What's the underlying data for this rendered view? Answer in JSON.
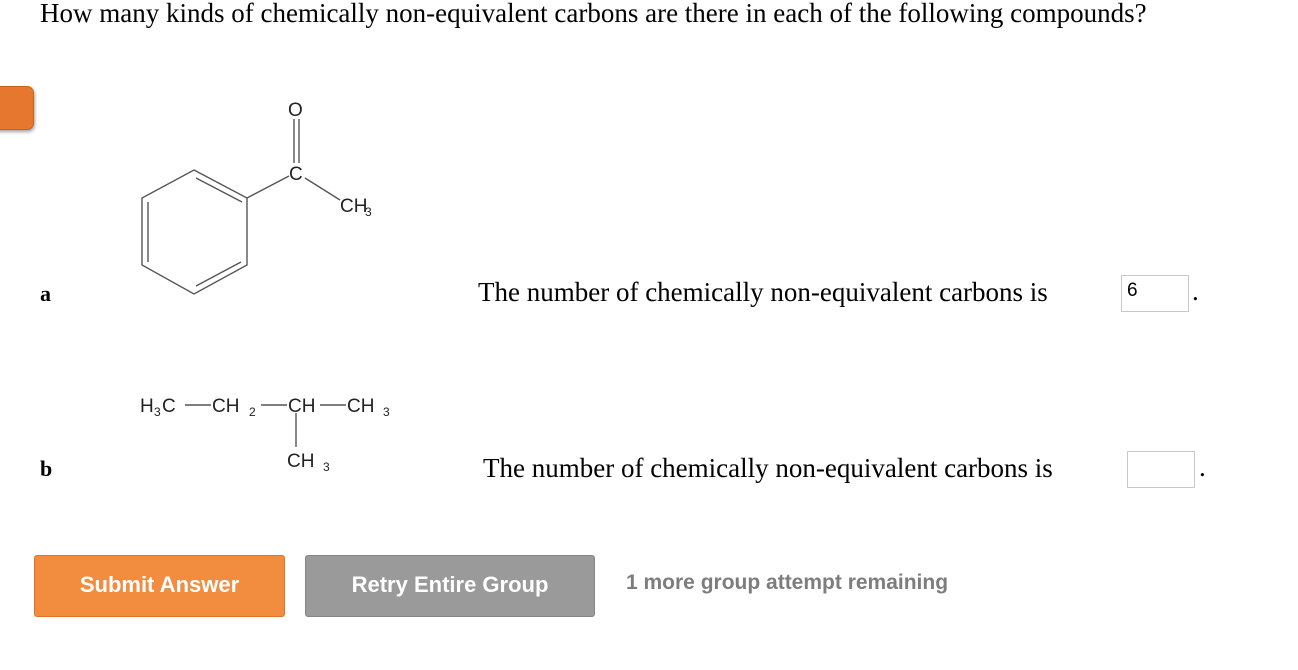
{
  "question": {
    "text": "How many kinds of chemically non-equivalent carbons are there in each of the following compounds?"
  },
  "parts": [
    {
      "label": "a",
      "sentence": "The number of chemically non-equivalent carbons is",
      "answer_value": "6",
      "period": "."
    },
    {
      "label": "b",
      "sentence": "The number of chemically non-equivalent carbons is",
      "answer_value": "",
      "period": "."
    }
  ],
  "molecule_a": {
    "oxygen": "O",
    "carbon": "C",
    "methyl": "CH",
    "methyl_sub": "3"
  },
  "molecule_b": {
    "h": "H",
    "h_sub": "3",
    "c1": "C",
    "ch2": "CH",
    "ch2_sub": "2",
    "ch": "CH",
    "ch3_end": "CH",
    "ch3_end_sub": "3",
    "ch3_branch": "CH",
    "ch3_branch_sub": "3"
  },
  "buttons": {
    "submit": "Submit Answer",
    "retry": "Retry Entire Group"
  },
  "attempts": {
    "text": "1 more group attempt remaining"
  },
  "colors": {
    "submit": "#f28d3f",
    "retry": "#9a9a9a",
    "side_tab": "#e6772e",
    "attempts_text": "#7d7d7d"
  }
}
